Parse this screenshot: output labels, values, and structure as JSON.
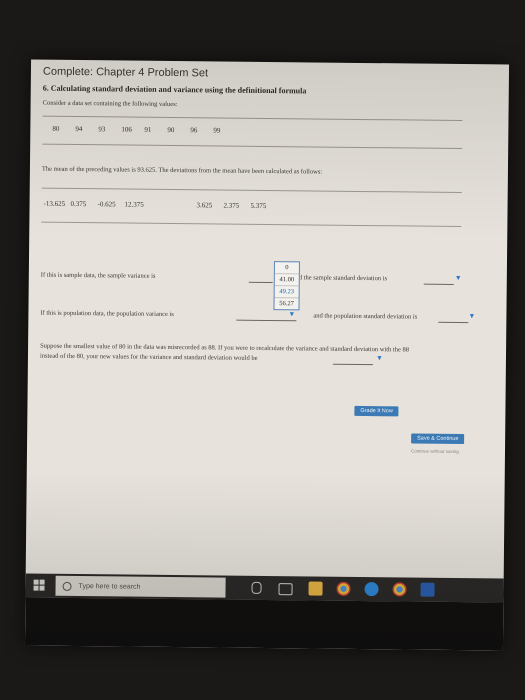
{
  "page": {
    "title": "Complete: Chapter 4 Problem Set",
    "heading": "6. Calculating standard deviation and variance using the definitional formula",
    "prompt": "Consider a data set containing the following values:",
    "values": [
      "80",
      "94",
      "93",
      "106",
      "91",
      "90",
      "96",
      "99"
    ],
    "mean_text": "The mean of the preceding values is 93.625. The deviations from the mean have been calculated as follows:",
    "deviations": [
      "-13.625",
      "0.375",
      "-0.625",
      "12.375",
      "",
      "3.625",
      "2.375",
      "5.375"
    ],
    "sample_text": "If this is sample data, the sample variance is",
    "sample_sd_text": "d the sample standard deviation is",
    "population_text": "If this is population data, the population variance is",
    "population_sd_text": "and the population standard deviation is",
    "followup_line1": "Suppose the smallest value of 80 in the data was misrecorded as 88. If you were to recalculate the variance and standard deviation with the 88",
    "followup_line2": "instead of the 80, your new values for the variance and standard deviation would be",
    "dropdown_options": [
      "0",
      "41.00",
      "49.23",
      "56.27"
    ]
  },
  "buttons": {
    "grade": "Grade It Now",
    "save": "Save & Continue",
    "continue_note": "Continue without saving"
  },
  "taskbar": {
    "search_placeholder": "Type here to search",
    "icons": [
      "windows-logo-icon",
      "microphone-icon",
      "task-view-icon",
      "file-explorer-icon",
      "chrome-icon",
      "edge-icon",
      "chrome-icon",
      "word-icon"
    ],
    "colors": {
      "taskbar": "#2c2a28",
      "accent": "#3b7ab5"
    }
  }
}
